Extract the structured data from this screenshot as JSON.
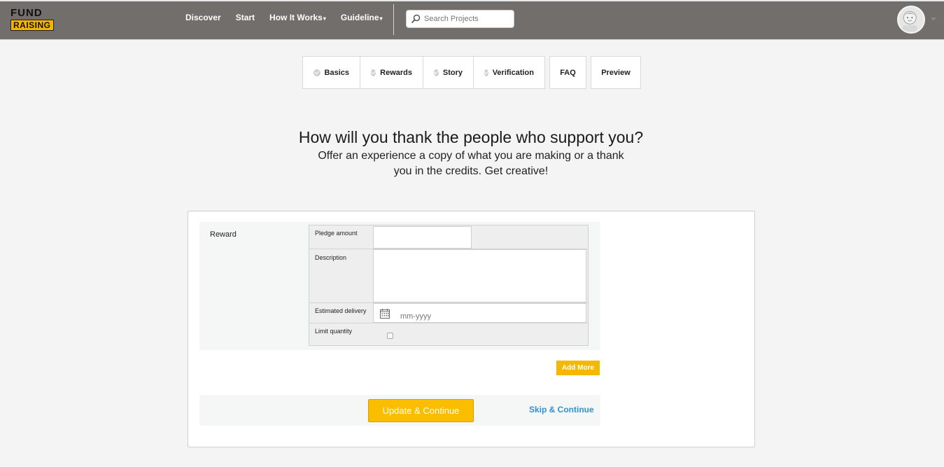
{
  "logo": {
    "line1": "FUND",
    "line2": "RAISING"
  },
  "nav": {
    "items": [
      {
        "label": "Discover",
        "dropdown": false
      },
      {
        "label": "Start",
        "dropdown": false
      },
      {
        "label": "How It Works",
        "dropdown": true
      },
      {
        "label": "Guideline",
        "dropdown": true
      }
    ],
    "caret": "▾"
  },
  "search": {
    "placeholder": "Search Projects",
    "icon": "search-icon"
  },
  "user": {
    "avatar_icon": "user-avatar-icon"
  },
  "steps": {
    "group": [
      {
        "label": "Basics"
      },
      {
        "label": "Rewards"
      },
      {
        "label": "Story"
      },
      {
        "label": "Verification"
      }
    ],
    "faq": "FAQ",
    "preview": "Preview"
  },
  "intro": {
    "title": "How will you thank the people who support you?",
    "subtitle": "Offer an experience a copy of what you are making or a thank you in the credits. Get creative!"
  },
  "form": {
    "section_label": "Reward",
    "pledge_label": "Pledge amount",
    "pledge_value": "",
    "description_label": "Description",
    "description_value": "",
    "delivery_label": "Estimated delivery",
    "delivery_placeholder": "mm-yyyy",
    "limit_label": "Limit quantity",
    "limit_checked": false,
    "add_more": "Add More",
    "update_button": "Update & Continue",
    "skip_link": "Skip & Continue"
  },
  "colors": {
    "header_bg": "#716e6c",
    "accent": "#fbbd00",
    "link": "#2b93d6"
  }
}
